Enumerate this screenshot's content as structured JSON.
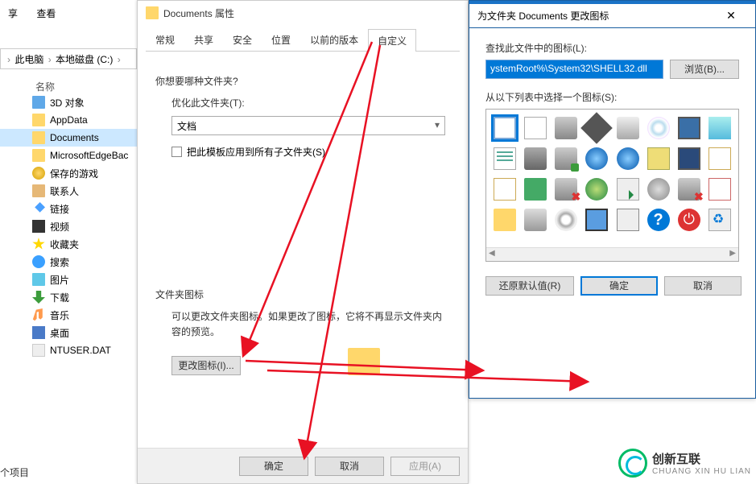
{
  "explorer": {
    "menu": {
      "file": "享",
      "view": "查看"
    },
    "breadcrumb": {
      "p1": "此电脑",
      "p2": "本地磁盘 (C:)",
      "sep": "›"
    },
    "col_name": "名称",
    "items": [
      {
        "label": "3D 对象",
        "iconClass": "ic-folder-b"
      },
      {
        "label": "AppData",
        "iconClass": "ic-folder-y"
      },
      {
        "label": "Documents",
        "iconClass": "ic-folder-y",
        "selected": true
      },
      {
        "label": "MicrosoftEdgeBac",
        "iconClass": "ic-folder-y"
      },
      {
        "label": "保存的游戏",
        "iconClass": "ic-trophy"
      },
      {
        "label": "联系人",
        "iconClass": "ic-contacts"
      },
      {
        "label": "链接",
        "iconClass": "ic-link"
      },
      {
        "label": "视频",
        "iconClass": "ic-video"
      },
      {
        "label": "收藏夹",
        "iconClass": "ic-star"
      },
      {
        "label": "搜索",
        "iconClass": "ic-search"
      },
      {
        "label": "图片",
        "iconClass": "ic-pic"
      },
      {
        "label": "下载",
        "iconClass": "ic-dl"
      },
      {
        "label": "音乐",
        "iconClass": "ic-music"
      },
      {
        "label": "桌面",
        "iconClass": "ic-desktop"
      },
      {
        "label": "NTUSER.DAT",
        "iconClass": "ic-file"
      }
    ],
    "footer": "个项目"
  },
  "props": {
    "title": "Documents 属性",
    "tabs": [
      "常规",
      "共享",
      "安全",
      "位置",
      "以前的版本",
      "自定义"
    ],
    "active_tab_index": 5,
    "q1": "你想要哪种文件夹?",
    "opt_label": "优化此文件夹(T):",
    "opt_value": "文档",
    "chk_label": "把此模板应用到所有子文件夹(S)",
    "g2_title": "文件夹图标",
    "g2_desc": "可以更改文件夹图标。如果更改了图标，它将不再显示文件夹内容的预览。",
    "change_btn": "更改图标(I)...",
    "ok": "确定",
    "cancel": "取消",
    "apply": "应用(A)"
  },
  "icon_dlg": {
    "title": "为文件夹 Documents 更改图标",
    "lbl_path": "查找此文件中的图标(L):",
    "path_value": "ystemRoot%\\System32\\SHELL32.dll",
    "browse": "浏览(B)...",
    "lbl_grid": "从以下列表中选择一个图标(S):",
    "restore": "还原默认值(R)",
    "ok": "确定",
    "cancel": "取消"
  },
  "watermark": {
    "cn": "创新互联",
    "en": "CHUANG XIN HU LIAN"
  }
}
